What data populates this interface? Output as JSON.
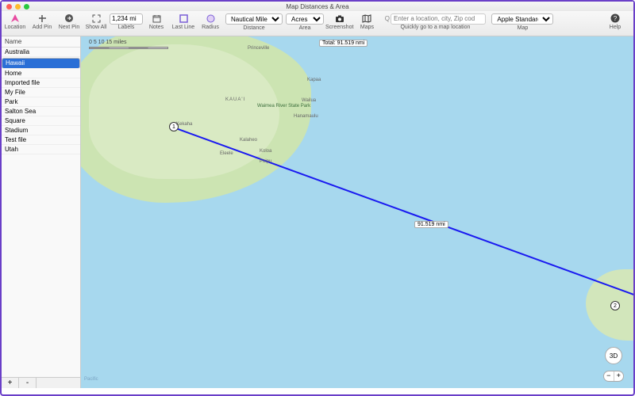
{
  "window": {
    "title": "Map Distances & Area"
  },
  "toolbar": {
    "location": "Location",
    "addpin": "Add Pin",
    "nextpin": "Next Pin",
    "showall": "Show All",
    "labels": "Labels",
    "notes": "Notes",
    "lastline": "Last Line",
    "radius": "Radius",
    "distance": "Distance",
    "area": "Area",
    "screenshot": "Screenshot",
    "maps": "Maps",
    "goto": "Quickly go to a map location",
    "map": "Map",
    "help": "Help",
    "measure_value": "1,234 mi",
    "dist_unit": "Nautical Miles",
    "area_unit": "Acres",
    "search_placeholder": "Enter a location, city, Zip cod",
    "map_style": "Apple Standard"
  },
  "sidebar": {
    "header": "Name",
    "items": [
      "Australia",
      "Hawaii",
      "Home",
      "Imported file",
      "My File",
      "Park",
      "Salton Sea",
      "Square",
      "Stadium",
      "Test file",
      "Utah"
    ],
    "selected": 1,
    "add": "+",
    "remove": "-"
  },
  "map": {
    "scale": {
      "ticks": "0       5       10   15 miles"
    },
    "total_label": "Total: 91.519 nmi",
    "segment_label": "91.519 nmi",
    "point1": "1",
    "point2": "2",
    "ctrl3d": "3D",
    "zoom_out": "−",
    "zoom_in": "+",
    "park": "Waimea River\nState Park",
    "places": {
      "princeville": "Princeville",
      "kapaa": "Kapaa",
      "wailua": "Wailua",
      "kauai": "KAUA'I",
      "kekaha": "Kekaha",
      "kalaheo": "Kalaheo",
      "koloa": "Koloa",
      "poipu": "Poipu",
      "eleele": "Eleele",
      "hanamaulu": "Hanamaulu",
      "pacific": "Pacific"
    }
  }
}
